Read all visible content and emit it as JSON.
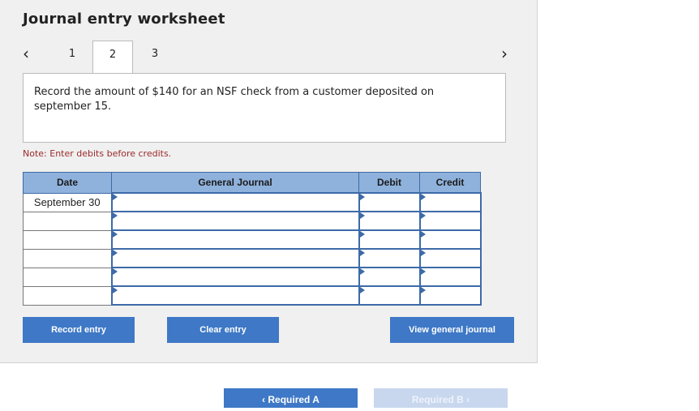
{
  "title": "Journal entry worksheet",
  "nav": {
    "prev_icon": "‹",
    "next_icon": "›"
  },
  "tabs": [
    {
      "label": "1"
    },
    {
      "label": "2",
      "active": true
    },
    {
      "label": "3"
    }
  ],
  "prompt": "Record the amount of $140 for an NSF check from a customer deposited on september 15.",
  "note": "Note: Enter debits before credits.",
  "table": {
    "headers": {
      "date": "Date",
      "journal": "General Journal",
      "debit": "Debit",
      "credit": "Credit"
    },
    "rows": [
      {
        "date": "September 30",
        "journal": "",
        "debit": "",
        "credit": ""
      },
      {
        "date": "",
        "journal": "",
        "debit": "",
        "credit": ""
      },
      {
        "date": "",
        "journal": "",
        "debit": "",
        "credit": ""
      },
      {
        "date": "",
        "journal": "",
        "debit": "",
        "credit": ""
      },
      {
        "date": "",
        "journal": "",
        "debit": "",
        "credit": ""
      },
      {
        "date": "",
        "journal": "",
        "debit": "",
        "credit": ""
      }
    ]
  },
  "buttons": {
    "record": "Record entry",
    "clear": "Clear entry",
    "view": "View general journal"
  },
  "footer": {
    "required_a": "‹  Required A",
    "required_b": "Required B  ›"
  },
  "colors": {
    "accent": "#3e78c6",
    "header_bg": "#8fb2dc",
    "note": "#9c2a2a"
  }
}
